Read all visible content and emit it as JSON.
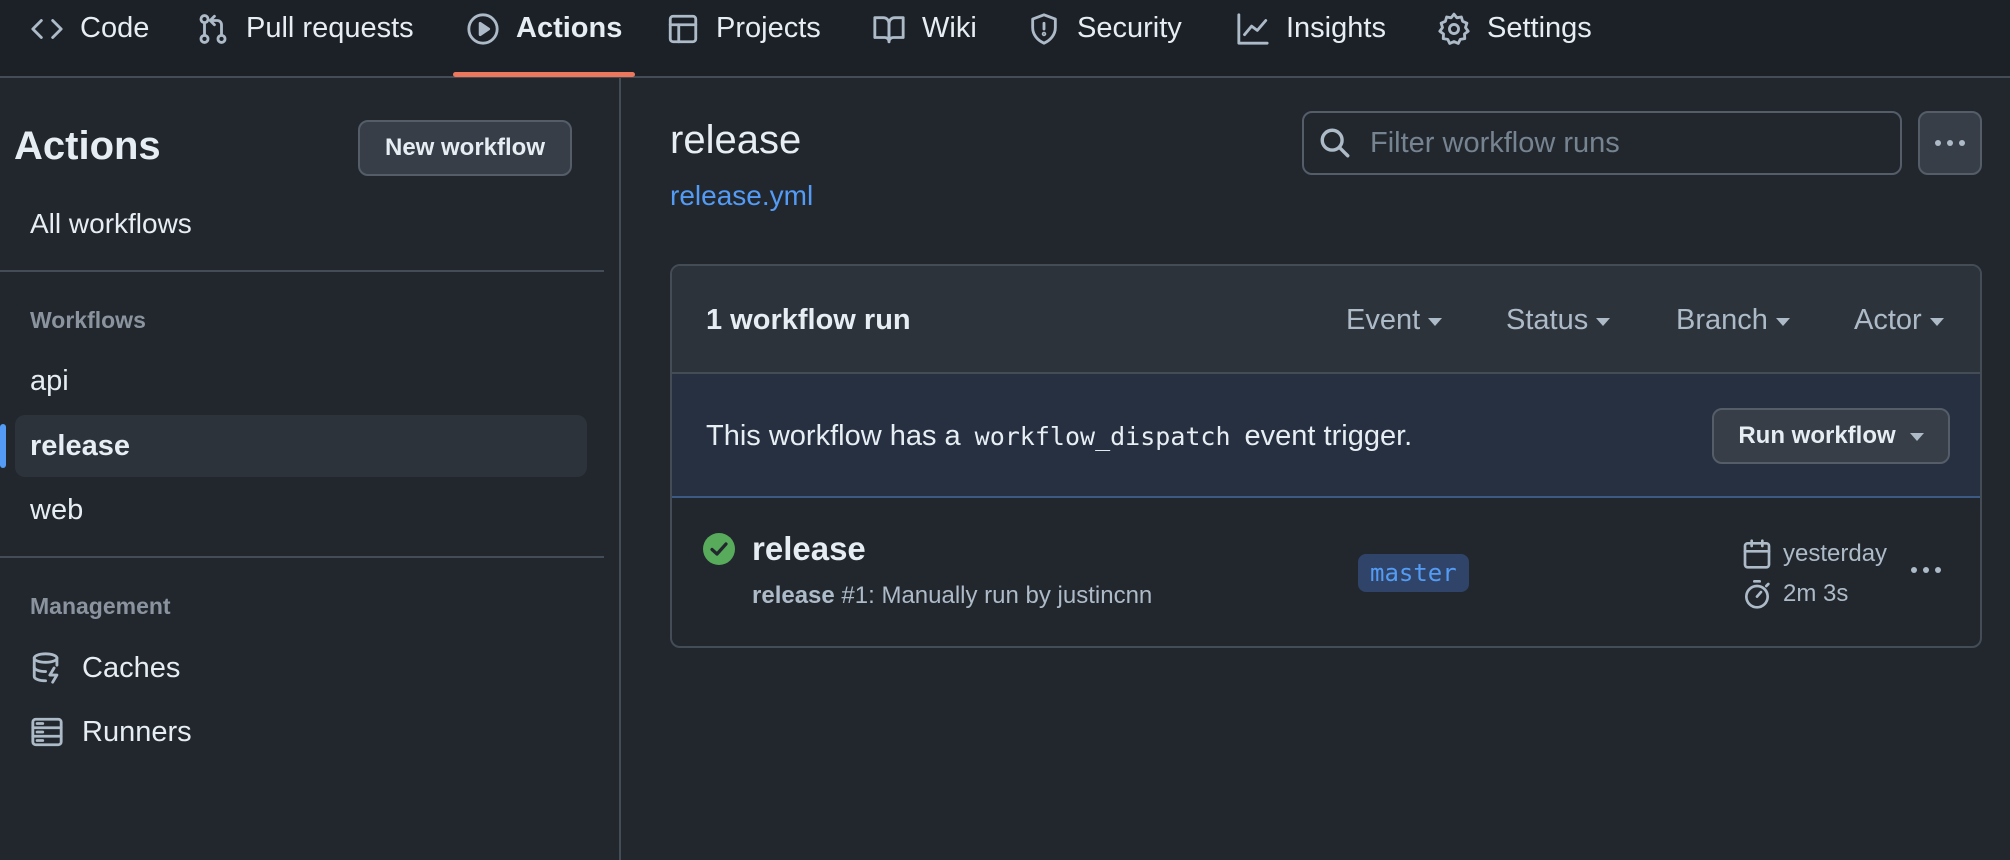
{
  "nav": {
    "tabs": [
      {
        "label": "Code",
        "icon": "code-icon"
      },
      {
        "label": "Pull requests",
        "icon": "pull-request-icon"
      },
      {
        "label": "Actions",
        "icon": "play-circle-icon",
        "active": true
      },
      {
        "label": "Projects",
        "icon": "table-icon"
      },
      {
        "label": "Wiki",
        "icon": "book-icon"
      },
      {
        "label": "Security",
        "icon": "shield-icon"
      },
      {
        "label": "Insights",
        "icon": "graph-icon"
      },
      {
        "label": "Settings",
        "icon": "gear-icon"
      }
    ],
    "active_underline_color": "#ec775c"
  },
  "sidebar": {
    "title": "Actions",
    "new_workflow_label": "New workflow",
    "all_workflows_label": "All workflows",
    "workflows_section_label": "Workflows",
    "workflows": [
      {
        "label": "api"
      },
      {
        "label": "release",
        "selected": true
      },
      {
        "label": "web"
      }
    ],
    "management_section_label": "Management",
    "management": [
      {
        "label": "Caches",
        "icon": "database-icon"
      },
      {
        "label": "Runners",
        "icon": "server-icon"
      }
    ]
  },
  "main": {
    "title": "release",
    "file_link": "release.yml",
    "filter_placeholder": "Filter workflow runs",
    "runs": {
      "count_label": "1 workflow run",
      "filters": [
        "Event",
        "Status",
        "Branch",
        "Actor"
      ],
      "dispatch": {
        "text_before": "This workflow has a",
        "code": "workflow_dispatch",
        "text_after": "event trigger.",
        "button_label": "Run workflow"
      },
      "items": [
        {
          "title": "release",
          "sub_bold": "release",
          "sub_rest": " #1: Manually run by justincnn",
          "branch": "master",
          "when": "yesterday",
          "duration": "2m 3s",
          "status": "success"
        }
      ]
    }
  },
  "colors": {
    "background": "#22272e",
    "accent_link": "#539bf5",
    "success": "#57ab5a"
  }
}
